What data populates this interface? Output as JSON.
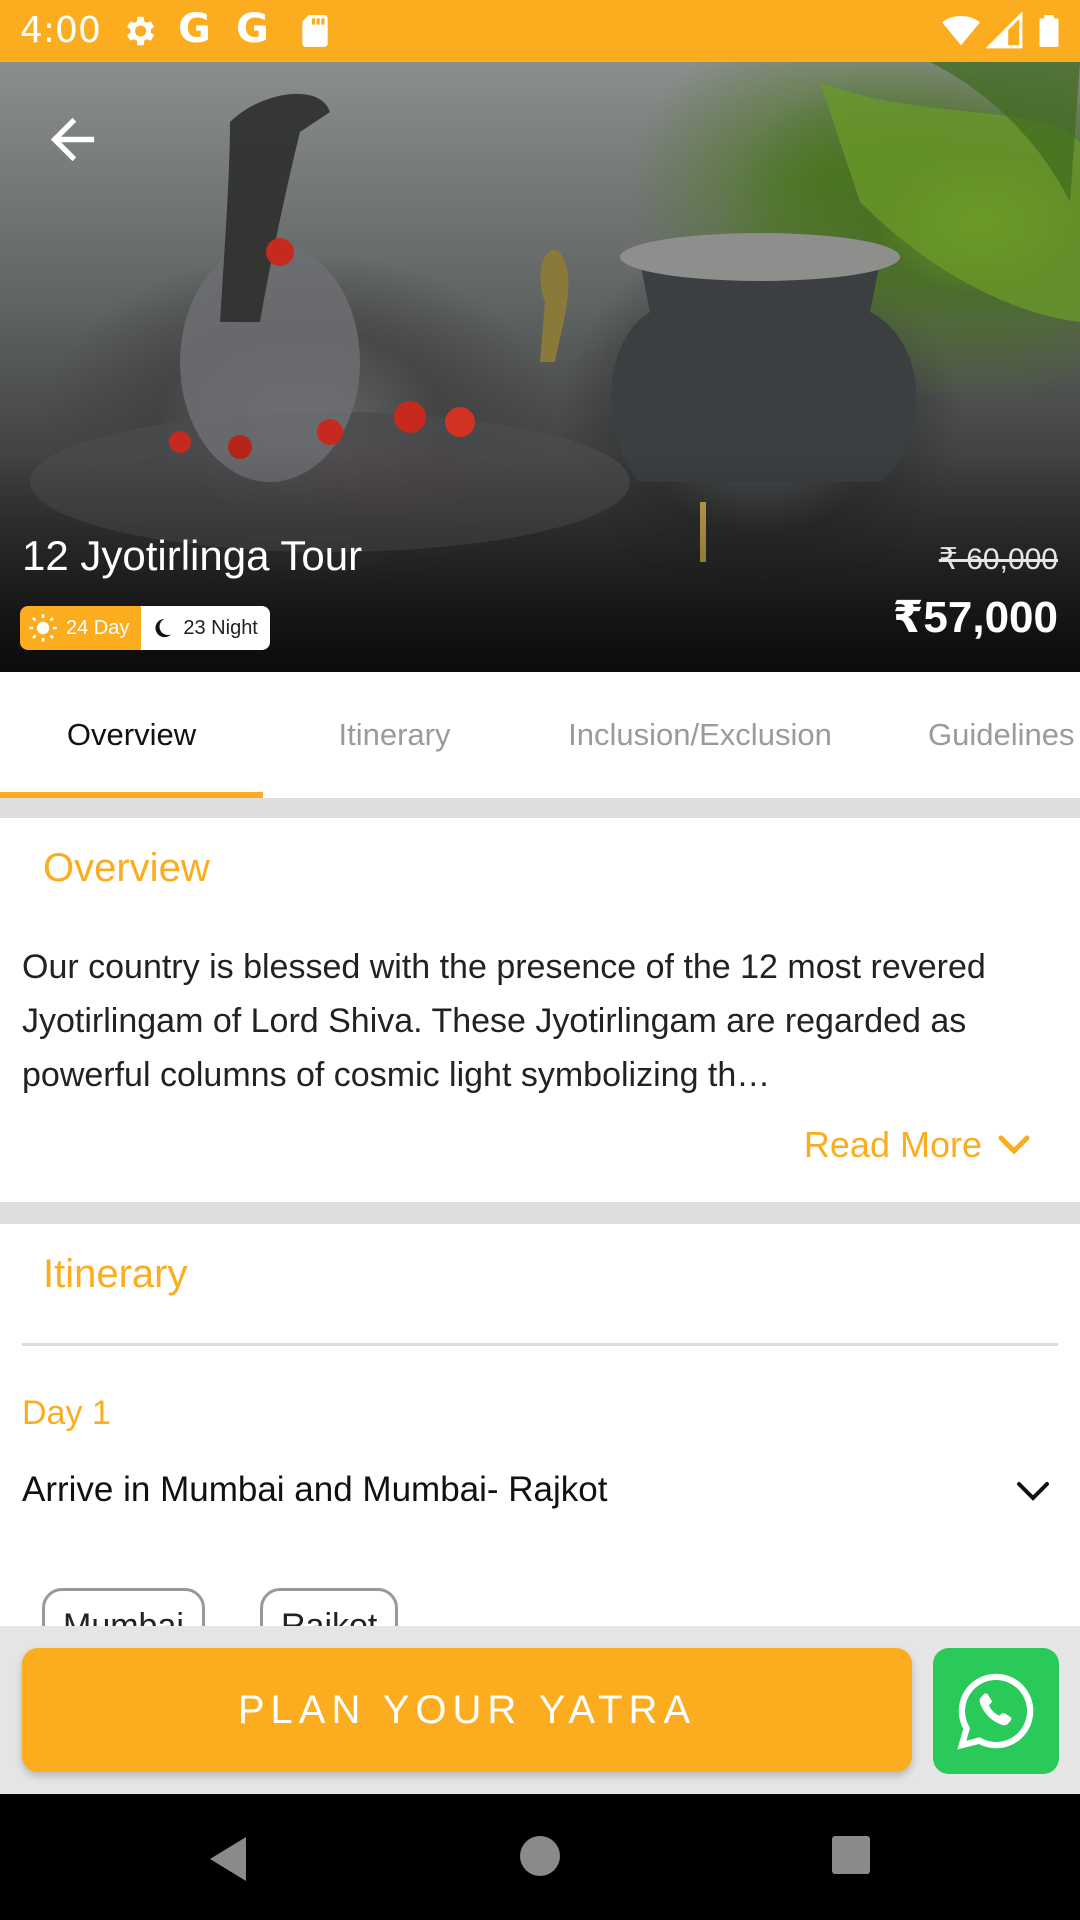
{
  "status_bar": {
    "time": "4:00",
    "icons": [
      "settings-icon",
      "google-icon",
      "google-icon",
      "sd-card-icon",
      "wifi-icon",
      "signal-icon",
      "battery-icon"
    ],
    "g1": "G",
    "g2": "G"
  },
  "hero": {
    "title": "12 Jyotirlinga Tour",
    "original_price": "₹ 60,000",
    "price": "₹57,000",
    "days": "24 Day",
    "nights": "23 Night"
  },
  "tabs": [
    {
      "label": "Overview",
      "active": true
    },
    {
      "label": "Itinerary",
      "active": false
    },
    {
      "label": "Inclusion/Exclusion",
      "active": false
    },
    {
      "label": "Guidelines",
      "active": false
    }
  ],
  "overview": {
    "heading": "Overview",
    "text": "Our country is blessed with the presence of the 12 most revered Jyotirlingam of Lord Shiva. These Jyotirlingam are regarded as powerful columns of cosmic light symbolizing th…",
    "read_more": "Read More"
  },
  "itinerary": {
    "heading": "Itinerary",
    "day_label": "Day 1",
    "day_title": "Arrive in Mumbai and Mumbai- Rajkot",
    "places": [
      "Mumbai",
      "Rajkot"
    ]
  },
  "actions": {
    "plan_label": "PLAN YOUR YATRA"
  },
  "colors": {
    "accent": "#fbad1f",
    "whatsapp": "#29c95a"
  }
}
